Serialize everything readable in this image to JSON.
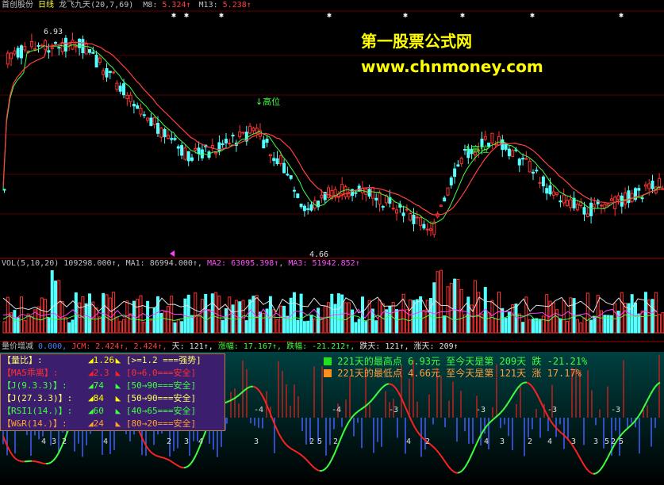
{
  "price_panel": {
    "title": "首创股份",
    "period": "日线",
    "indicator": "龙飞九天",
    "params": "(20,7,69)",
    "ma8_label": "M8:",
    "ma8_value": "5.324↑",
    "ma13_label": "M13:",
    "ma13_value": "5.238↑",
    "high_mark": "6.93",
    "low_mark": "4.66",
    "peak_label": "高位",
    "peak_label_2": "高位"
  },
  "watermark": {
    "line1": "第一股票公式网",
    "line2": "www.chnmoney.com"
  },
  "volume_panel": {
    "label": "VOL(5,10,20)",
    "vol_value": "109298.000↑",
    "ma1_label": "MA1:",
    "ma1_value": "86994.000↑",
    "ma2_label": "MA2:",
    "ma2_value": "63095.398↑",
    "ma3_label": "MA3:",
    "ma3_value": "51942.852↑"
  },
  "indicator_panel": {
    "label": "量价增减",
    "v0": "0.000,",
    "jcm": "JCM: 2.424↑, 2.424↑,",
    "tian": "天: 121↑,",
    "zhangfu": "涨幅: 17.167↑,",
    "diefu": "跌幅: -21.212↑,",
    "dietian": "跌天: 121↑,",
    "zhangtian": "涨天: 209↑",
    "info_high": "221天的最高点 6.93元 至今天是第 209天 跌  -21.21%",
    "info_low": "221天的最低点 4.66元 至今天是第 121天 涨  17.17%",
    "neg_labels": [
      "-4",
      "-4",
      "-3",
      "-3",
      "-3",
      "-3"
    ],
    "bottom_labels": [
      "4",
      "3",
      "2",
      "4",
      "2",
      "3",
      "4",
      "3",
      "2",
      "5",
      "2",
      "4",
      "2",
      "4",
      "3",
      "2",
      "4",
      "3",
      "3",
      "5",
      "2",
      "5"
    ]
  },
  "stat_panel": {
    "rows": [
      {
        "label": "【量比】:",
        "value": "1.26",
        "range": "[>=1.2 ===强势]"
      },
      {
        "label": "【MA5乖离】:",
        "value": "2.3",
        "range": "[0→6.0===安全]"
      },
      {
        "label": "【J(9.3.3)】:",
        "value": "74",
        "range": "[50→90===安全]"
      },
      {
        "label": "【J(27.3.3)】:",
        "value": "84",
        "range": "[50→90===安全]"
      },
      {
        "label": "【RSI1(14.)】:",
        "value": "60",
        "range": "[40→65===安全]"
      },
      {
        "label": "【W&R(14.)】:",
        "value": "24",
        "range": "[80→20===安全]"
      }
    ]
  },
  "colors": {
    "up": "#ff3232",
    "down": "#54ffff",
    "bg": "#000000",
    "axis": "#a00000",
    "ma8": "#ff5050",
    "ma13": "#50ff50"
  }
}
